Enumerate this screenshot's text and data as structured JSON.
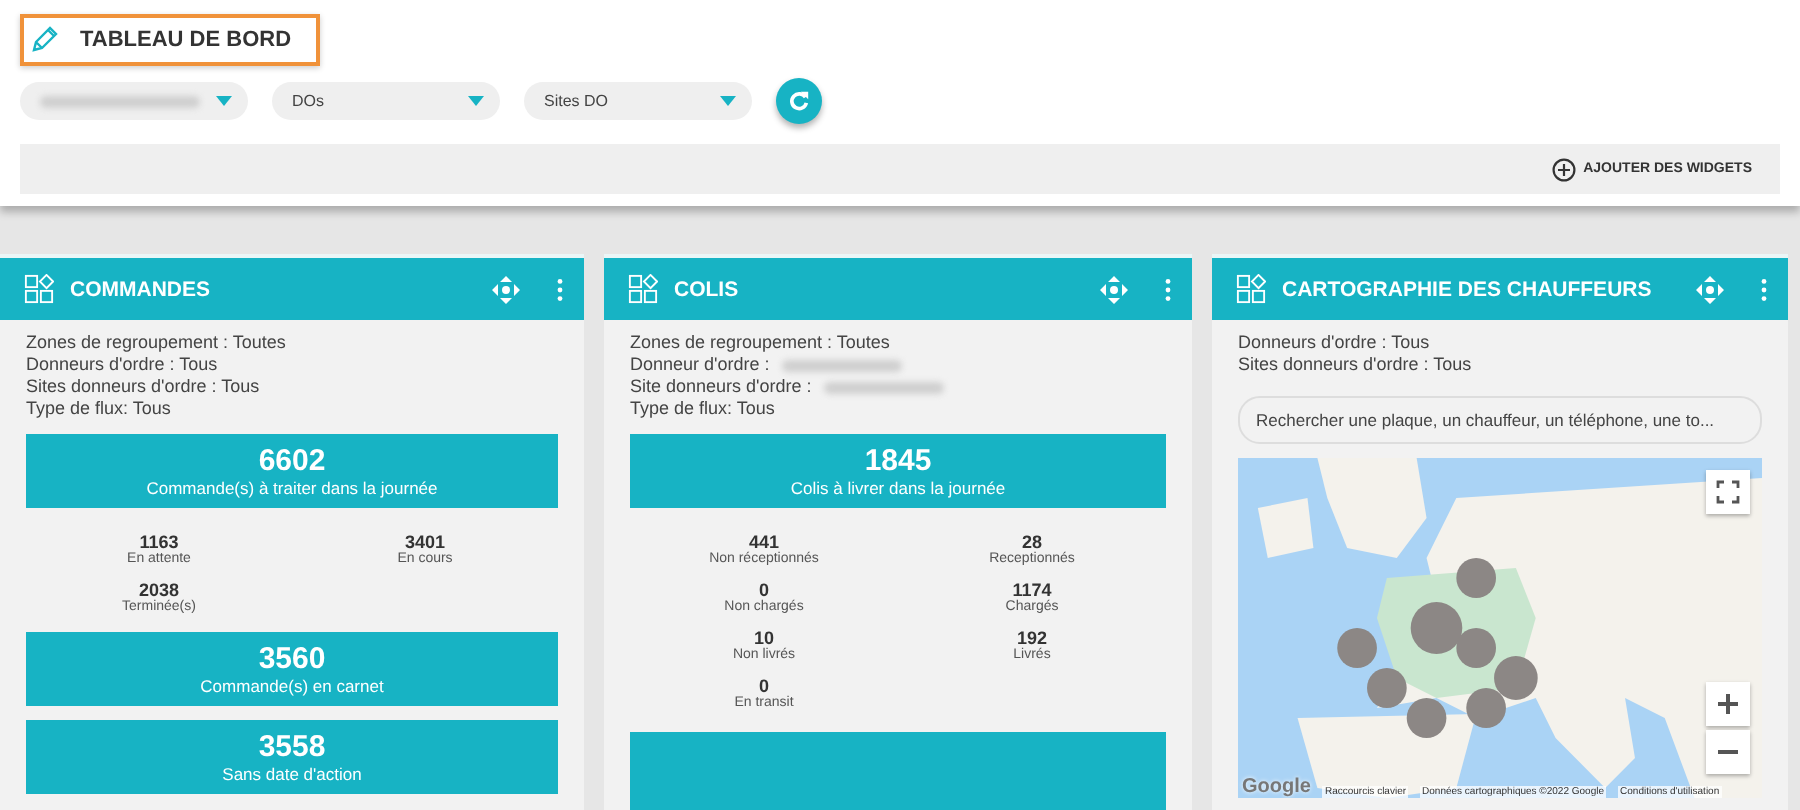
{
  "title": "TABLEAU DE BORD",
  "filters": [
    {
      "kind": "blurred"
    },
    {
      "kind": "select",
      "label": "DOs"
    },
    {
      "kind": "select",
      "label": "Sites DO"
    }
  ],
  "add_widgets": "AJOUTER DES WIDGETS",
  "widgets": [
    {
      "kind": "stats",
      "title": "COMMANDES",
      "lines": [
        {
          "kind": "plain",
          "text": "Zones de regroupement : Toutes"
        },
        {
          "kind": "plain",
          "text": "Donneurs d'ordre : Tous"
        },
        {
          "kind": "plain",
          "text": "Sites donneurs d'ordre : Tous"
        },
        {
          "kind": "plain",
          "text": "Type de flux: Tous"
        }
      ],
      "blocks": [
        {
          "kind": "kpi",
          "value": "6602",
          "label": "Commande(s) à traiter dans la journée"
        },
        {
          "kind": "stats",
          "items": [
            {
              "value": "1163",
              "label": "En attente"
            },
            {
              "value": "3401",
              "label": "En cours"
            },
            {
              "value": "2038",
              "label": "Terminée(s)"
            }
          ]
        },
        {
          "kind": "kpi",
          "value": "3560",
          "label": "Commande(s) en carnet"
        },
        {
          "kind": "kpi",
          "value": "3558",
          "label": "Sans date d'action"
        }
      ]
    },
    {
      "kind": "stats",
      "title": "COLIS",
      "lines": [
        {
          "kind": "plain",
          "text": "Zones de regroupement : Toutes"
        },
        {
          "kind": "redacted",
          "text": "Donneur d'ordre :"
        },
        {
          "kind": "redacted",
          "text": "Site donneurs d'ordre :"
        },
        {
          "kind": "plain",
          "text": "Type de flux: Tous"
        }
      ],
      "blocks": [
        {
          "kind": "kpi",
          "value": "1845",
          "label": "Colis à livrer dans la journée"
        },
        {
          "kind": "stats",
          "items": [
            {
              "value": "441",
              "label": "Non réceptionnés"
            },
            {
              "value": "28",
              "label": "Receptionnés"
            },
            {
              "value": "0",
              "label": "Non chargés"
            },
            {
              "value": "1174",
              "label": "Chargés"
            },
            {
              "value": "10",
              "label": "Non livrés"
            },
            {
              "value": "192",
              "label": "Livrés"
            },
            {
              "value": "0",
              "label": "En transit"
            }
          ]
        },
        {
          "kind": "kpi_cut"
        }
      ]
    },
    {
      "kind": "map",
      "title": "CARTOGRAPHIE DES CHAUFFEURS",
      "lines": [
        {
          "kind": "plain",
          "text": "Donneurs d'ordre : Tous"
        },
        {
          "kind": "plain",
          "text": "Sites donneurs d'ordre : Tous"
        }
      ],
      "search": {
        "placeholder": "Rechercher une plaque, un chauffeur, un téléphone, une to..."
      },
      "map": {
        "kind": "picture",
        "logo": "Google",
        "attribution": [
          "Raccourcis clavier",
          "Données cartographiques ©2022 Google",
          "Conditions d'utilisation"
        ]
      }
    }
  ]
}
